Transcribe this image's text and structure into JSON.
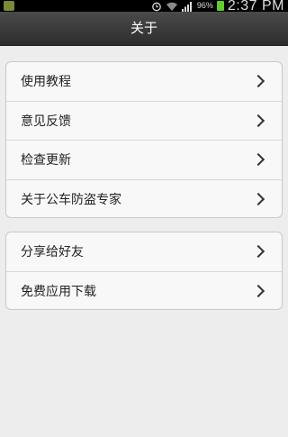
{
  "status_bar": {
    "battery_percent": "96%",
    "time": "2:37 PM",
    "battery_color": "#5fce2a",
    "icons": [
      "notification-icon",
      "alarm-icon",
      "wifi-icon",
      "signal-icon",
      "battery-icon"
    ]
  },
  "header": {
    "title": "关于"
  },
  "menu": {
    "group1": [
      {
        "label": "使用教程",
        "icon": "chevron-right-icon"
      },
      {
        "label": "意见反馈",
        "icon": "chevron-right-icon"
      },
      {
        "label": "检查更新",
        "icon": "chevron-right-icon"
      },
      {
        "label": "关于公车防盗专家",
        "icon": "chevron-right-icon"
      }
    ],
    "group2": [
      {
        "label": "分享给好友",
        "icon": "chevron-right-icon"
      },
      {
        "label": "免费应用下载",
        "icon": "chevron-right-icon"
      }
    ]
  },
  "colors": {
    "header_bg": "#2d2d2d",
    "page_bg": "#ededed",
    "card_bg": "#f8f8f8"
  }
}
